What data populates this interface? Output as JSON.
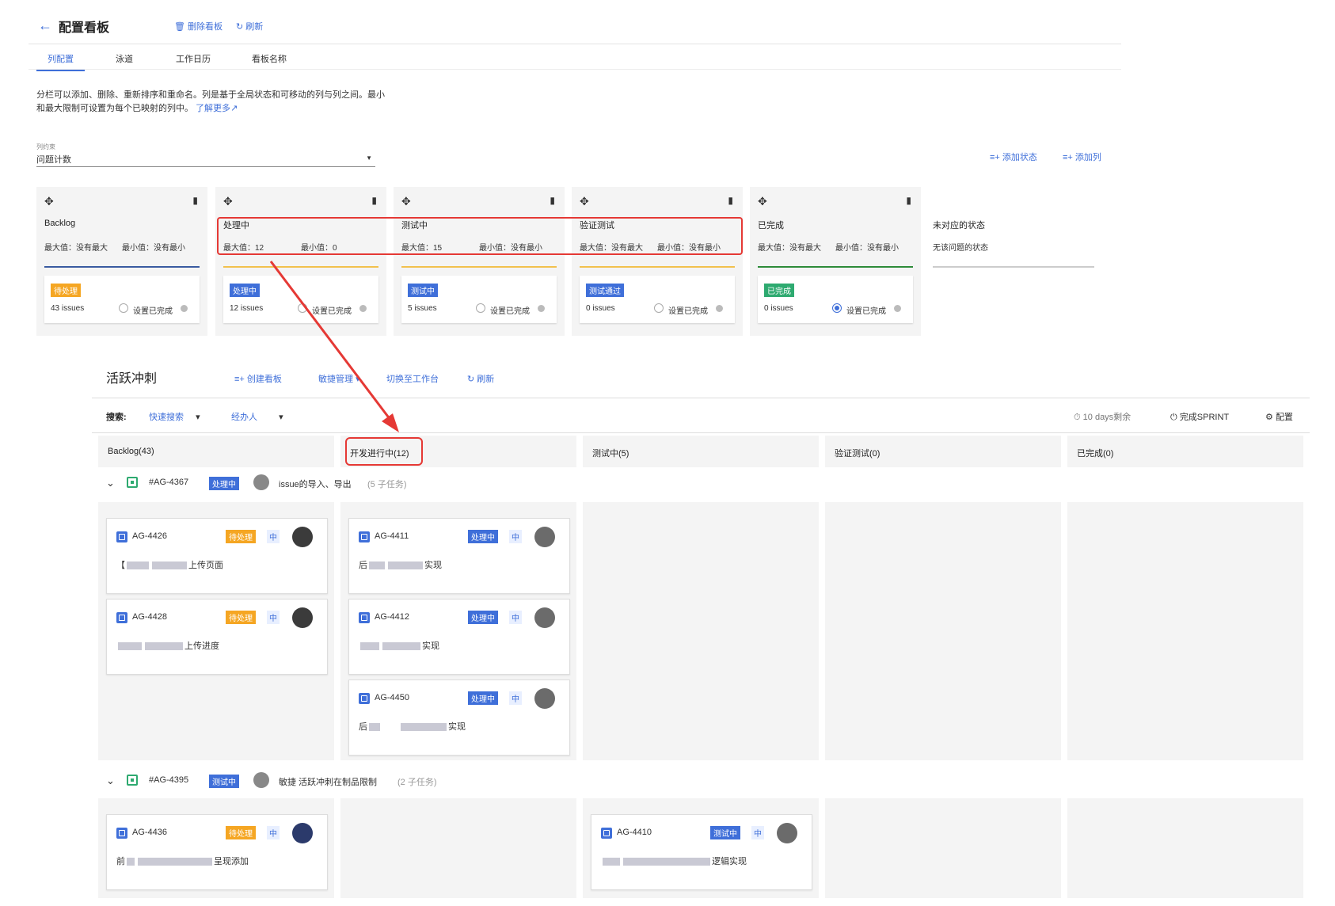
{
  "config": {
    "title": "配置看板",
    "delete_board": "删除看板",
    "refresh": "刷新",
    "tabs": [
      "列配置",
      "泳道",
      "工作日历",
      "看板名称"
    ],
    "description": "分栏可以添加、删除、重新排序和重命名。列是基于全局状态和可移动的列与列之间。最小和最大限制可设置为每个已映射的列中。",
    "learn_more": "了解更多",
    "constraint_label": "列约束",
    "constraint_value": "问题计数",
    "add_status": "添加状态",
    "add_column": "添加列",
    "set_done_label": "设置已完成",
    "columns": [
      {
        "name": "Backlog",
        "max": "最大值：没有最大",
        "min": "最小值：没有最小",
        "status": "待处理",
        "count": "43 issues"
      },
      {
        "name": "处理中",
        "max": "最大值：12",
        "min": "最小值：0",
        "status": "处理中",
        "count": "12 issues"
      },
      {
        "name": "测试中",
        "max": "最大值：15",
        "min": "最小值：没有最小",
        "status": "测试中",
        "count": "5 issues"
      },
      {
        "name": "验证测试",
        "max": "最大值：没有最大",
        "min": "最小值：没有最小",
        "status": "测试通过",
        "count": "0 issues"
      },
      {
        "name": "已完成",
        "max": "最大值：没有最大",
        "min": "最小值：没有最小",
        "status": "已完成",
        "count": "0 issues"
      }
    ],
    "unmapped_title": "未对应的状态",
    "unmapped_desc": "无该问题的状态"
  },
  "sprint": {
    "title": "活跃冲刺",
    "create_board": "创建看板",
    "agile_manage": "敏捷管理",
    "switch_workbench": "切换至工作台",
    "refresh": "刷新",
    "search_label": "搜索:",
    "quick_search": "快速搜索",
    "assignee": "经办人",
    "days_left": "10 days剩余",
    "complete_sprint": "完成SPRINT",
    "config": "配置",
    "columns": [
      "Backlog(43)",
      "开发进行中(12)",
      "测试中(5)",
      "验证测试(0)",
      "已完成(0)"
    ],
    "swimlanes": [
      {
        "key": "#AG-4367",
        "status": "处理中",
        "summary": "issue的导入、导出",
        "subtasks": "(5 子任务)"
      },
      {
        "key": "#AG-4395",
        "status": "测试中",
        "summary": "敏捷 活跃冲刺在制品限制",
        "subtasks": "(2 子任务)"
      }
    ],
    "cards": {
      "c4426": {
        "key": "AG-4426",
        "status": "待处理",
        "priority": "中",
        "summary_a": "【",
        "summary_b": "上传页面"
      },
      "c4428": {
        "key": "AG-4428",
        "status": "待处理",
        "priority": "中",
        "summary_a": "",
        "summary_b": "上传进度"
      },
      "c4411": {
        "key": "AG-4411",
        "status": "处理中",
        "priority": "中",
        "summary_a": "后",
        "summary_b": "实现"
      },
      "c4412": {
        "key": "AG-4412",
        "status": "处理中",
        "priority": "中",
        "summary_a": "",
        "summary_b": "实现"
      },
      "c4450": {
        "key": "AG-4450",
        "status": "处理中",
        "priority": "中",
        "summary_a": "后",
        "summary_b": "实现"
      },
      "c4436": {
        "key": "AG-4436",
        "status": "待处理",
        "priority": "中",
        "summary_a": "前",
        "summary_b": "呈现添加"
      },
      "c4410": {
        "key": "AG-4410",
        "status": "测试中",
        "priority": "中",
        "summary_a": "",
        "summary_b": "逻辑实现"
      }
    }
  },
  "colors": {
    "accent": "#3f6fd9",
    "todo": "#f5a623",
    "inprogress": "#3f6fd9",
    "done": "#2eaa70",
    "highlight": "#e53935",
    "backlog_line": "#3a5ba0",
    "progress_line": "#f2c14e",
    "done_line": "#2e8b3a"
  }
}
